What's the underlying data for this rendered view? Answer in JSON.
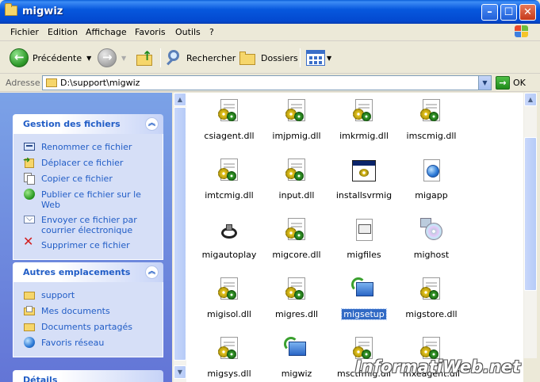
{
  "window": {
    "title": "migwiz"
  },
  "menu": [
    "Fichier",
    "Edition",
    "Affichage",
    "Favoris",
    "Outils",
    "?"
  ],
  "toolbar": {
    "back_label": "Précédente",
    "search_label": "Rechercher",
    "folders_label": "Dossiers"
  },
  "address": {
    "label": "Adresse",
    "value": "D:\\support\\migwiz",
    "go_label": "OK"
  },
  "tasks": {
    "file_tasks": {
      "title": "Gestion des fichiers",
      "items": [
        {
          "label": "Renommer ce fichier",
          "icon": "rename-icon"
        },
        {
          "label": "Déplacer ce fichier",
          "icon": "move-icon"
        },
        {
          "label": "Copier ce fichier",
          "icon": "copy-icon"
        },
        {
          "label": "Publier ce fichier sur le Web",
          "icon": "publish-web-icon"
        },
        {
          "label": "Envoyer ce fichier par courrier électronique",
          "icon": "email-icon"
        },
        {
          "label": "Supprimer ce fichier",
          "icon": "delete-icon"
        }
      ]
    },
    "other_places": {
      "title": "Autres emplacements",
      "items": [
        {
          "label": "support",
          "icon": "folder-icon"
        },
        {
          "label": "Mes documents",
          "icon": "my-documents-icon"
        },
        {
          "label": "Documents partagés",
          "icon": "shared-documents-icon"
        },
        {
          "label": "Favoris réseau",
          "icon": "network-places-icon"
        }
      ]
    },
    "details": {
      "title": "Détails"
    }
  },
  "files": [
    {
      "name": "csiagent.dll",
      "type": "dll"
    },
    {
      "name": "imjpmig.dll",
      "type": "dll"
    },
    {
      "name": "imkrmig.dll",
      "type": "dll"
    },
    {
      "name": "imscmig.dll",
      "type": "dll"
    },
    {
      "name": "imtcmig.dll",
      "type": "dll"
    },
    {
      "name": "input.dll",
      "type": "dll"
    },
    {
      "name": "installsvrmig",
      "type": "exe"
    },
    {
      "name": "migapp",
      "type": "htm"
    },
    {
      "name": "migautoplay",
      "type": "cable"
    },
    {
      "name": "migcore.dll",
      "type": "dll"
    },
    {
      "name": "migfiles",
      "type": "exe2"
    },
    {
      "name": "mighost",
      "type": "cd"
    },
    {
      "name": "migisol.dll",
      "type": "dll"
    },
    {
      "name": "migres.dll",
      "type": "dll"
    },
    {
      "name": "migsetup",
      "type": "setup",
      "selected": true
    },
    {
      "name": "migstore.dll",
      "type": "dll"
    },
    {
      "name": "migsys.dll",
      "type": "dll"
    },
    {
      "name": "migwiz",
      "type": "setup"
    },
    {
      "name": "msctfmig.dll",
      "type": "dll"
    },
    {
      "name": "mxeagent.dll",
      "type": "dll"
    }
  ],
  "watermark": "InformatiWeb.net",
  "colors": {
    "title_bar": "#0758dd",
    "task_link": "#215dc6",
    "selection": "#316ac5"
  }
}
